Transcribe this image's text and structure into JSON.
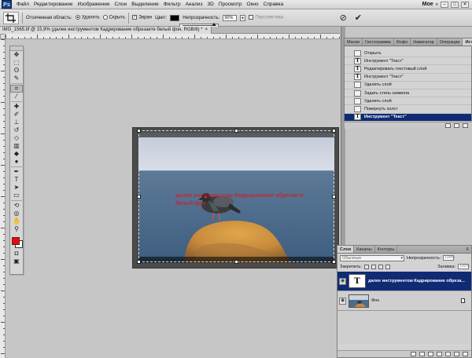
{
  "app": {
    "logo": "Ps",
    "menu": [
      "Файл",
      "Редактирование",
      "Изображение",
      "Слои",
      "Выделение",
      "Фильтр",
      "Анализ",
      "3D",
      "Просмотр",
      "Окно",
      "Справка"
    ],
    "workspace": "Мое",
    "window_controls": [
      "–",
      "□",
      "✕"
    ]
  },
  "options_bar": {
    "cropped_area_label": "Отсеченная область:",
    "delete_label": "Удалить",
    "hide_label": "Скрыть",
    "shield_label": "Экран",
    "color_label": "Цвет:",
    "shield_color": "#000000",
    "opacity_label": "Непрозрачность:",
    "opacity_value": "90%",
    "opacity_level": 0.9,
    "perspective_label": "Перспектива",
    "cancel_symbol": "⊘",
    "commit_symbol": "✔"
  },
  "document": {
    "tab_title": "IMG_1565.tif @ 15,9% (далее инструментом Кадрирование обрезаете  белый фон, RGB/8) *",
    "close_symbol": "×",
    "canvas_text": "далее инструментом Кадрирование обрезаете белый фон"
  },
  "toolbox": {
    "foreground_color": "#ff0000",
    "background_color": "#ffffff"
  },
  "history_panel": {
    "tabs": [
      "Маски",
      "Гистограмма",
      "Инфо",
      "Навигатор",
      "Операции",
      "История"
    ],
    "active_tab": "История",
    "items": [
      {
        "label": "Открыть",
        "icon": "doc-icon",
        "glyph": ""
      },
      {
        "label": "Инструмент \"Текст\"",
        "icon": "type-icon",
        "glyph": "T"
      },
      {
        "label": "Редактировать текстовый слой",
        "icon": "type-icon",
        "glyph": "T"
      },
      {
        "label": "Инструмент \"Текст\"",
        "icon": "type-icon",
        "glyph": "T"
      },
      {
        "label": "Удалить слой",
        "icon": "doc-icon",
        "glyph": ""
      },
      {
        "label": "Задать стиль символа",
        "icon": "doc-icon",
        "glyph": ""
      },
      {
        "label": "Удалить слой",
        "icon": "doc-icon",
        "glyph": ""
      },
      {
        "label": "Повернуть холст",
        "icon": "doc-icon",
        "glyph": ""
      },
      {
        "label": "Инструмент \"Текст\"",
        "icon": "type-icon",
        "glyph": "T",
        "selected": true
      }
    ]
  },
  "layers_panel": {
    "tabs": [
      "Слои",
      "Каналы",
      "Контуры"
    ],
    "active_tab": "Слои",
    "blend_mode": "Обычные",
    "opacity_label": "Непрозрачность:",
    "opacity_value": "100%",
    "lock_label": "Закрепить:",
    "fill_label": "Заливка:",
    "fill_value": "100%",
    "layers": [
      {
        "name": "далее инструментом Кадрирование обреза...",
        "type": "text",
        "thumb": "T",
        "selected": true
      },
      {
        "name": "Фон",
        "type": "image",
        "selected": false
      }
    ]
  },
  "colors": {
    "selection_blue": "#0f2b73",
    "text_red": "#e1121b",
    "workspace_gray": "#c6c6c6"
  }
}
